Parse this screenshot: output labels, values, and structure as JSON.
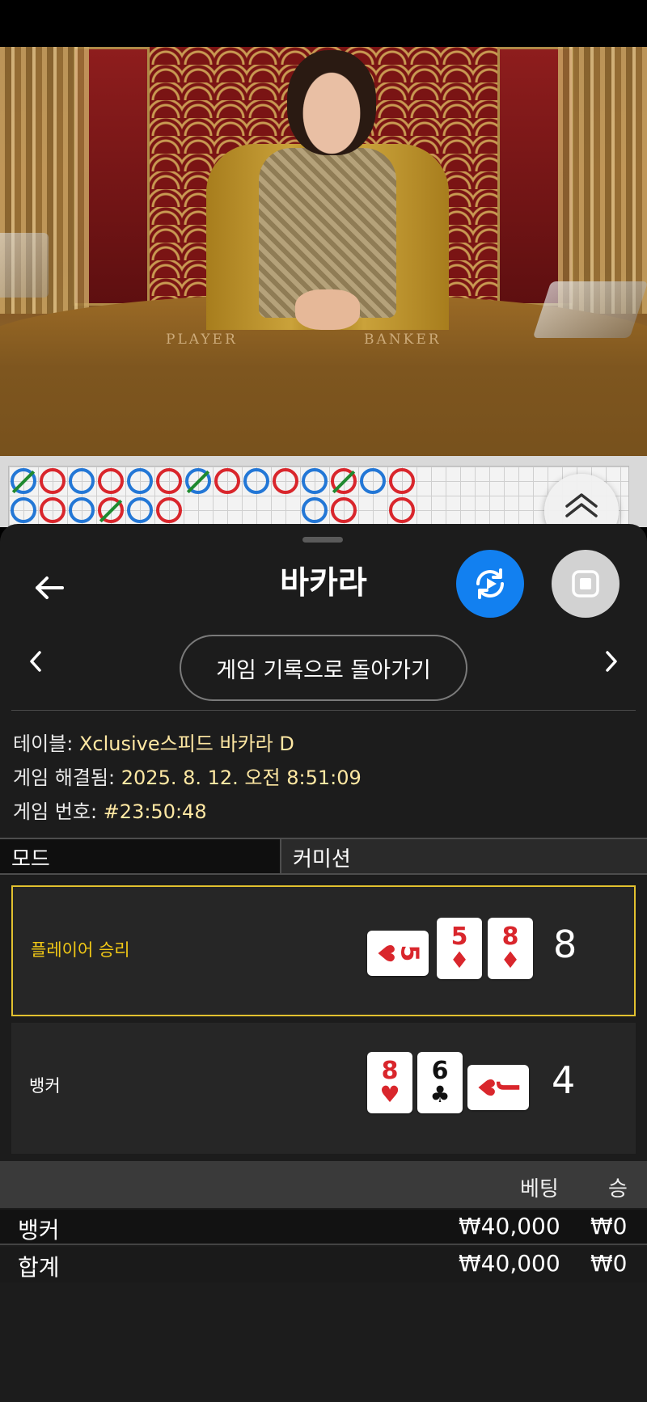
{
  "game": {
    "title": "바카라",
    "history_button_label": "게임 기록으로 돌아가기",
    "table_label": "테이블:",
    "table_value": "Xclusive스피드 바카라 D",
    "resolved_label": "게임 해결됨:",
    "resolved_value": "2025. 8. 12. 오전 8:51:09",
    "number_label": "게임 번호:",
    "number_value": "#23:50:48"
  },
  "video": {
    "table_player_text": "PLAYER",
    "table_banker_text": "BANKER"
  },
  "mode": {
    "left_label": "모드",
    "right_label": "커미션"
  },
  "hands": {
    "player": {
      "label": "플레이어 승리",
      "score": "8",
      "cards": [
        {
          "rank": "5",
          "suit": "♥",
          "orientation": "side"
        },
        {
          "rank": "5",
          "suit": "♦",
          "orientation": "up"
        },
        {
          "rank": "8",
          "suit": "♦",
          "orientation": "up"
        }
      ]
    },
    "banker": {
      "label": "뱅커",
      "score": "4",
      "cards": [
        {
          "rank": "8",
          "suit": "♥",
          "orientation": "up"
        },
        {
          "rank": "6",
          "suit": "♣",
          "orientation": "up"
        },
        {
          "rank": "J",
          "suit": "♥",
          "orientation": "side"
        }
      ]
    }
  },
  "bets": {
    "col_bet": "베팅",
    "col_win": "승",
    "rows": [
      {
        "label": "뱅커",
        "bet": "₩40,000",
        "win": "₩0"
      },
      {
        "label": "합계",
        "bet": "₩40,000",
        "win": "₩0"
      }
    ]
  },
  "roadmap": {
    "row1": [
      "T",
      "B",
      "P",
      "B",
      "P",
      "B",
      "T",
      "B",
      "P",
      "B",
      "P",
      "T",
      "P",
      "B"
    ],
    "row2": [
      "P",
      "B",
      "P",
      "T",
      "P",
      "B",
      "",
      "",
      "",
      "",
      "P",
      "B",
      "",
      "B"
    ]
  },
  "colors": {
    "accent": "#1280f0",
    "highlight": "#e2c12f",
    "info_value": "#ffe8a3",
    "banker_red": "#d9262c",
    "player_blue": "#2377d6",
    "tie_green": "#1f8a2f"
  },
  "icons": {
    "back": "back-arrow-icon",
    "replay": "replay-icon",
    "stop": "stop-icon",
    "prev": "chevron-left-icon",
    "next": "chevron-right-icon",
    "roadmap_toggle": "double-chevron-up-icon"
  }
}
